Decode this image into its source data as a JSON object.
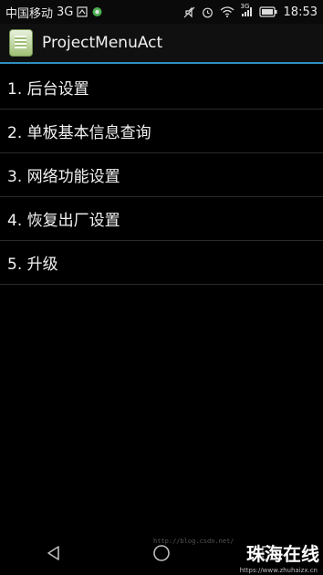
{
  "status_bar": {
    "carrier": "中国移动",
    "network": "3G",
    "network_small": "3G",
    "time": "18:53",
    "icons": [
      "sim-icon",
      "notification-icon",
      "mute-icon",
      "alarm-icon",
      "wifi-icon",
      "signal-icon",
      "battery-icon"
    ]
  },
  "app_bar": {
    "title": "ProjectMenuAct"
  },
  "menu": {
    "items": [
      {
        "label": "1. 后台设置"
      },
      {
        "label": "2. 单板基本信息查询"
      },
      {
        "label": "3. 网络功能设置"
      },
      {
        "label": "4. 恢复出厂设置"
      },
      {
        "label": "5. 升级"
      }
    ]
  },
  "nav_bar": {
    "buttons": [
      "back-icon",
      "home-icon",
      "recents-icon"
    ]
  },
  "watermark": {
    "url": "http://blog.csdn.net/",
    "brand": "珠海在线",
    "brand_url": "https://www.zhuhaizx.cn"
  }
}
